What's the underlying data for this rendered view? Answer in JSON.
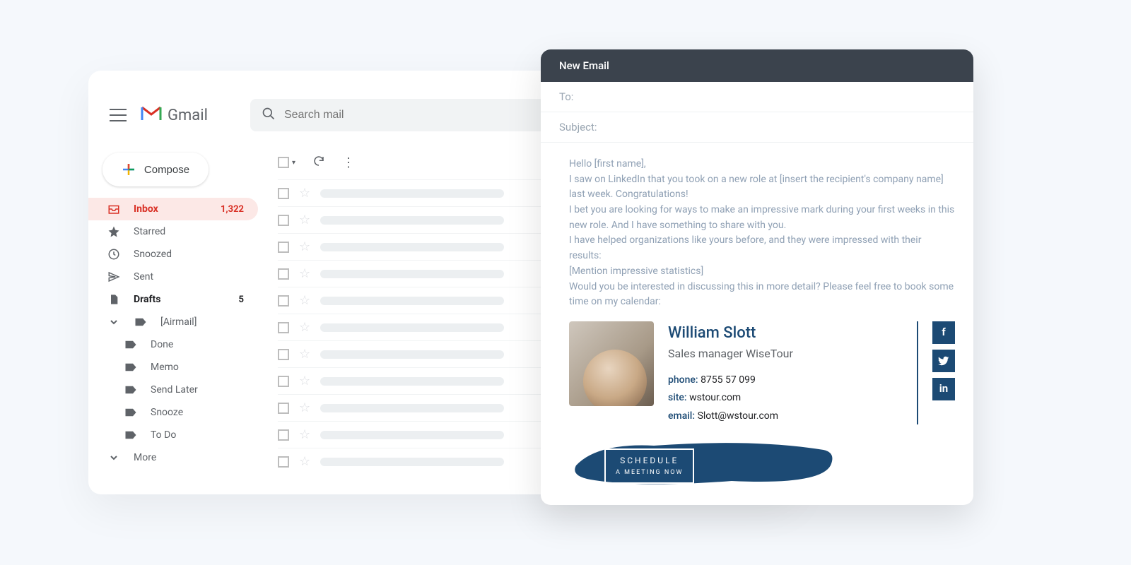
{
  "gmail": {
    "app_name": "Gmail",
    "search_placeholder": "Search mail",
    "compose_label": "Compose",
    "more_label": "More",
    "sidebar": [
      {
        "label": "Inbox",
        "count": "1,322",
        "active": true,
        "bold": true,
        "icon": "inbox"
      },
      {
        "label": "Starred",
        "count": "",
        "active": false,
        "bold": false,
        "icon": "star"
      },
      {
        "label": "Snoozed",
        "count": "",
        "active": false,
        "bold": false,
        "icon": "clock"
      },
      {
        "label": "Sent",
        "count": "",
        "active": false,
        "bold": false,
        "icon": "send"
      },
      {
        "label": "Drafts",
        "count": "5",
        "active": false,
        "bold": true,
        "icon": "file"
      },
      {
        "label": "[Airmail]",
        "count": "",
        "active": false,
        "bold": false,
        "icon": "label"
      }
    ],
    "sublabels": [
      {
        "label": "Done"
      },
      {
        "label": "Memo"
      },
      {
        "label": "Send Later"
      },
      {
        "label": "Snooze"
      },
      {
        "label": "To Do"
      }
    ]
  },
  "compose": {
    "title": "New Email",
    "to_label": "To:",
    "subject_label": "Subject:",
    "body_lines": [
      "Hello [first name],",
      "I saw on LinkedIn that you took on a new role at [insert the recipient's company name] last week. Congratulations!",
      "I bet you are looking for ways to make an impressive mark during your first weeks in this new role. And I have something to share with you.",
      "I have helped organizations like yours before, and they were impressed with their results:",
      "[Mention impressive statistics]",
      "Would you be interested in discussing this in more detail? Please feel free to book some time on my calendar:"
    ],
    "signature": {
      "name": "William Slott",
      "title_role": "Sales manager",
      "company": "WiseTour",
      "phone_label": "phone:",
      "phone": "8755 57 099",
      "site_label": "site:",
      "site": "wstour.com",
      "email_label": "email:",
      "email": "Slott@wstour.com"
    },
    "cta": {
      "line1": "SCHEDULE",
      "line2": "A MEETING NOW"
    }
  },
  "colors": {
    "accent_red": "#d93025",
    "brand_navy": "#1c4a74",
    "compose_header": "#3b434d"
  }
}
